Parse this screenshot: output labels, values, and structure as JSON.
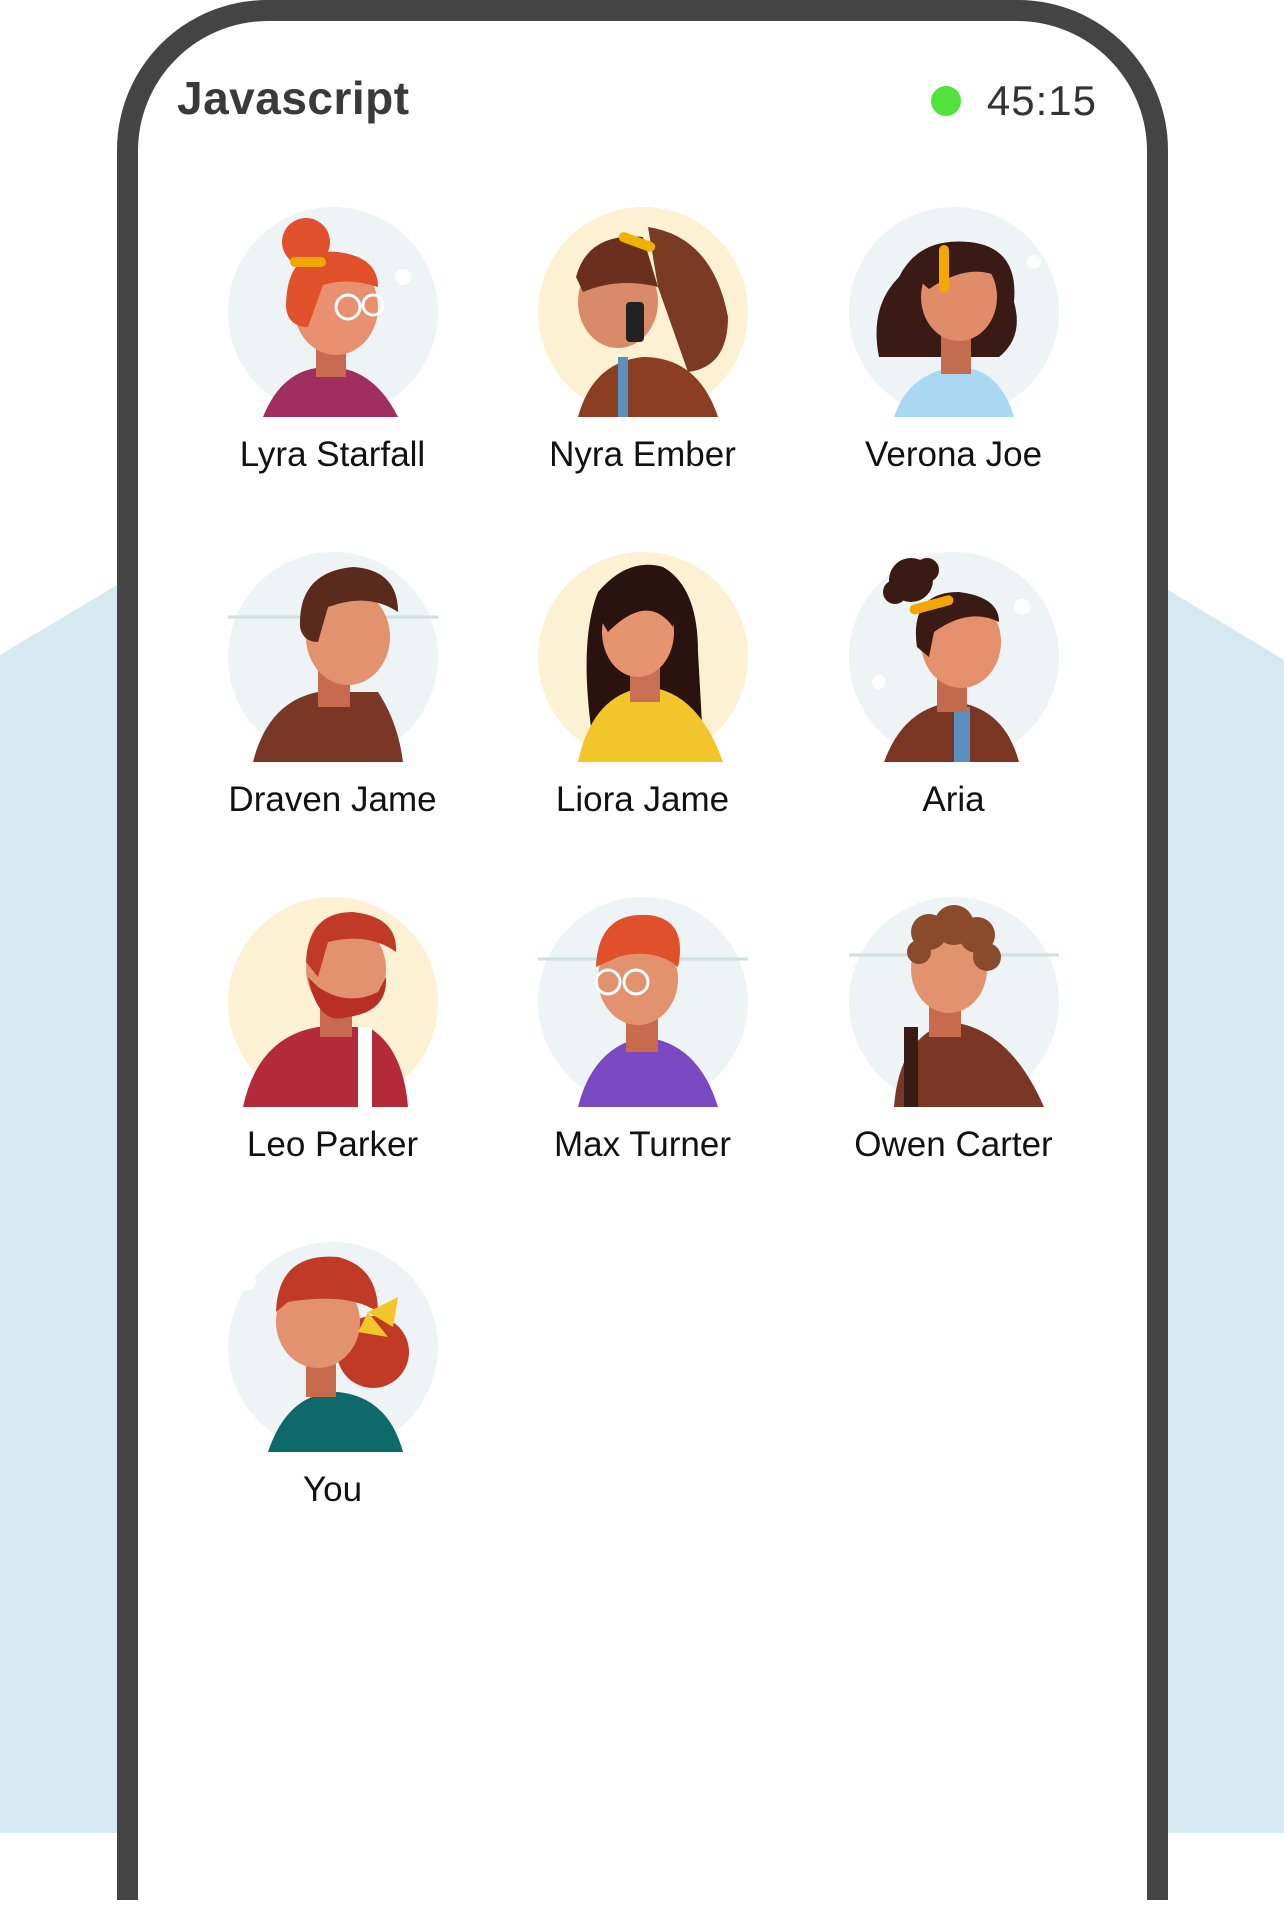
{
  "app": {
    "title": "Javascript"
  },
  "status": {
    "timer": "45:15",
    "indicator_color": "#52e33a"
  },
  "colors": {
    "backdrop": "#d6e8f0",
    "frame": "#444444",
    "screen": "#ffffff"
  },
  "players": [
    {
      "name": "Lyra Starfall",
      "icon": "avatar-woman-red-bun-glasses"
    },
    {
      "name": "Nyra Ember",
      "icon": "avatar-woman-ponytail-phone"
    },
    {
      "name": "Verona Joe",
      "icon": "avatar-woman-dark-hair-headband"
    },
    {
      "name": "Draven Jame",
      "icon": "avatar-man-brown-hair"
    },
    {
      "name": "Liora Jame",
      "icon": "avatar-woman-long-dark-hair"
    },
    {
      "name": "Aria",
      "icon": "avatar-woman-curly-bun"
    },
    {
      "name": "Leo Parker",
      "icon": "avatar-man-red-beard"
    },
    {
      "name": "Max Turner",
      "icon": "avatar-man-red-hair-glasses"
    },
    {
      "name": "Owen Carter",
      "icon": "avatar-man-curly-hair"
    },
    {
      "name": "You",
      "icon": "avatar-woman-red-hair-bow"
    }
  ]
}
